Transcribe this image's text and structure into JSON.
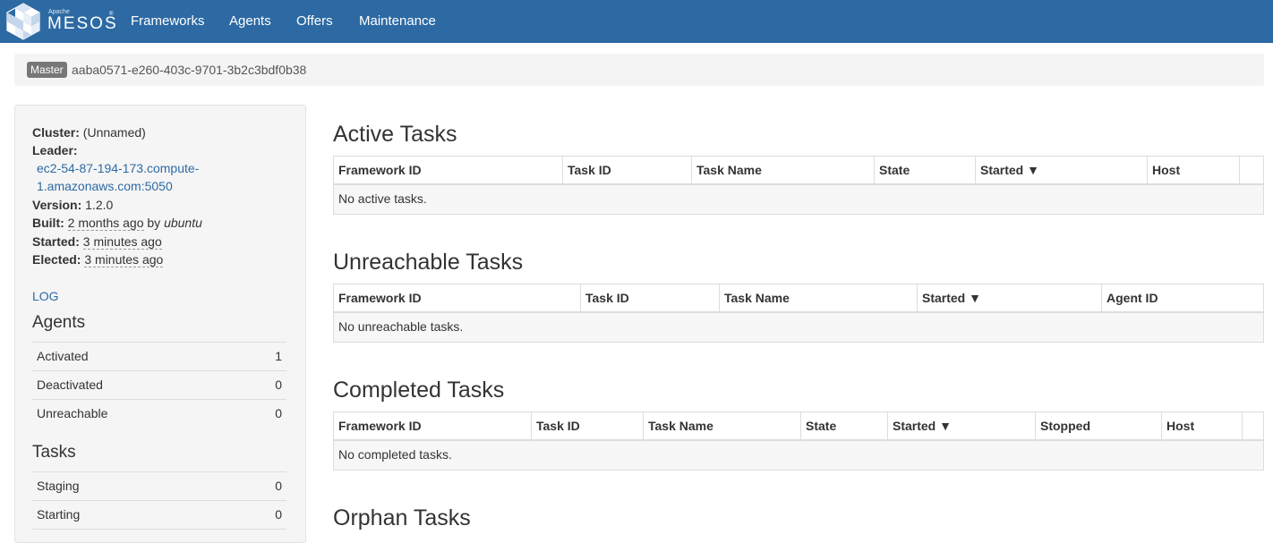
{
  "navbar": {
    "brand_apache": "Apache",
    "brand_name": "MESOS",
    "links": [
      "Frameworks",
      "Agents",
      "Offers",
      "Maintenance"
    ]
  },
  "master": {
    "badge": "Master",
    "id": "aaba0571-e260-403c-9701-3b2c3bdf0b38"
  },
  "sidebar": {
    "cluster_label": "Cluster:",
    "cluster_value": "(Unnamed)",
    "leader_label": "Leader:",
    "leader_line1": "ec2-54-87-194-173.compute-",
    "leader_line2": "1.amazonaws.com:5050",
    "version_label": "Version:",
    "version_value": "1.2.0",
    "built_label": "Built:",
    "built_value": "2 months ago",
    "built_by": "by",
    "built_user": "ubuntu",
    "started_label": "Started:",
    "started_value": "3 minutes ago",
    "elected_label": "Elected:",
    "elected_value": "3 minutes ago",
    "log_link": "LOG",
    "agents_heading": "Agents",
    "agents": [
      {
        "label": "Activated",
        "value": "1"
      },
      {
        "label": "Deactivated",
        "value": "0"
      },
      {
        "label": "Unreachable",
        "value": "0"
      }
    ],
    "tasks_heading": "Tasks",
    "tasks": [
      {
        "label": "Staging",
        "value": "0"
      },
      {
        "label": "Starting",
        "value": "0"
      }
    ]
  },
  "active": {
    "title": "Active Tasks",
    "headers": [
      "Framework ID",
      "Task ID",
      "Task Name",
      "State",
      "Started ▼",
      "Host"
    ],
    "empty": "No active tasks."
  },
  "unreachable": {
    "title": "Unreachable Tasks",
    "headers": [
      "Framework ID",
      "Task ID",
      "Task Name",
      "Started ▼",
      "Agent ID"
    ],
    "empty": "No unreachable tasks."
  },
  "completed": {
    "title": "Completed Tasks",
    "headers": [
      "Framework ID",
      "Task ID",
      "Task Name",
      "State",
      "Started ▼",
      "Stopped",
      "Host"
    ],
    "empty": "No completed tasks."
  },
  "orphan": {
    "title": "Orphan Tasks"
  }
}
